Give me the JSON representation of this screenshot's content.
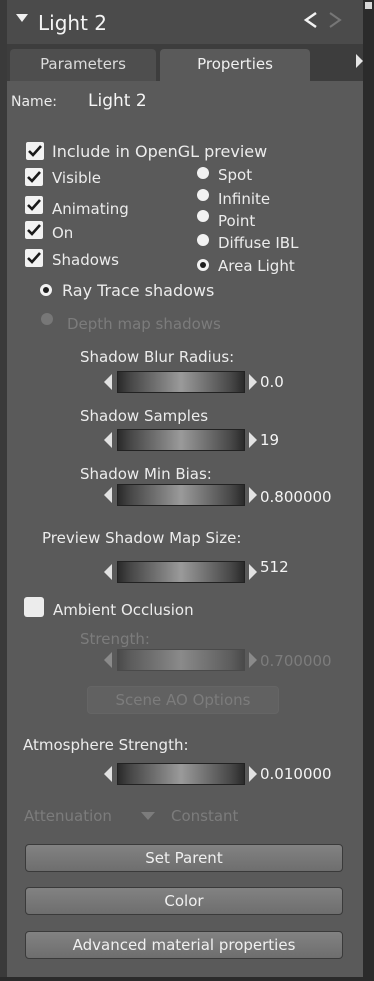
{
  "header": {
    "title": "Light 2",
    "back_icon": "chevron-left-icon",
    "forward_icon": "chevron-right-icon"
  },
  "tabs": [
    {
      "label": "Parameters",
      "active": false
    },
    {
      "label": "Properties",
      "active": true
    }
  ],
  "name_field": {
    "label": "Name:",
    "value": "Light 2"
  },
  "options": {
    "include_opengl": {
      "label": "Include in OpenGL preview",
      "checked": true
    },
    "visible": {
      "label": "Visible",
      "checked": true
    },
    "animating": {
      "label": "Animating",
      "checked": true
    },
    "on": {
      "label": "On",
      "checked": true
    },
    "shadows": {
      "label": "Shadows",
      "checked": true
    }
  },
  "light_types": [
    {
      "label": "Spot",
      "selected": false
    },
    {
      "label": "Infinite",
      "selected": false
    },
    {
      "label": "Point",
      "selected": false
    },
    {
      "label": "Diffuse IBL",
      "selected": false
    },
    {
      "label": "Area Light",
      "selected": true
    }
  ],
  "shadow_modes": {
    "ray_trace": {
      "label": "Ray Trace shadows",
      "selected": true
    },
    "depth_map": {
      "label": "Depth map shadows",
      "selected": false,
      "disabled": true
    }
  },
  "sliders": {
    "shadow_blur_radius": {
      "label": "Shadow Blur Radius:",
      "value": "0.0"
    },
    "shadow_samples": {
      "label": "Shadow Samples",
      "value": "19"
    },
    "shadow_min_bias": {
      "label": "Shadow Min Bias:",
      "value": "0.800000"
    },
    "preview_shadow_map_size": {
      "label": "Preview Shadow Map Size:",
      "value": "512"
    },
    "ao_strength": {
      "label": "Strength:",
      "value": "0.700000",
      "disabled": true
    },
    "atmosphere_strength": {
      "label": "Atmosphere Strength:",
      "value": "0.010000"
    }
  },
  "ambient_occlusion": {
    "label": "Ambient Occlusion",
    "checked": false
  },
  "scene_ao_button": "Scene AO Options",
  "attenuation": {
    "label": "Attenuation",
    "value": "Constant"
  },
  "buttons": {
    "set_parent": "Set Parent",
    "color": "Color",
    "advanced": "Advanced material properties"
  },
  "colors": {
    "panel": "#5a5a5a",
    "header": "#4b4b4b",
    "text": "#ececec",
    "disabled_text": "#7c7c7c"
  }
}
